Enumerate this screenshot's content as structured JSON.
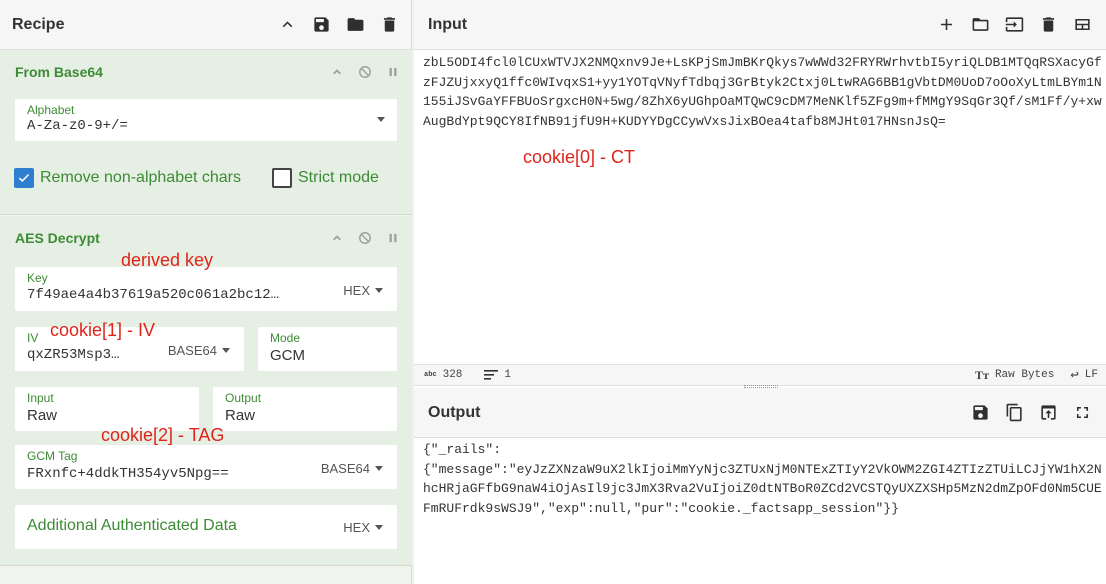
{
  "recipe": {
    "title": "Recipe"
  },
  "from_base64": {
    "name": "From Base64",
    "alphabet_label": "Alphabet",
    "alphabet_value": "A-Za-z0-9+/=",
    "remove_label": "Remove non-alphabet chars",
    "strict_label": "Strict mode"
  },
  "aes": {
    "name": "AES Decrypt",
    "key_label": "Key",
    "key_value": "7f49ae4a4b37619a520c061a2bc12…",
    "key_format": "HEX",
    "iv_label": "IV",
    "iv_value": "qxZR53Msp3…",
    "iv_format": "BASE64",
    "mode_label": "Mode",
    "mode_value": "GCM",
    "input_label": "Input",
    "input_value": "Raw",
    "output_label": "Output",
    "output_value": "Raw",
    "tag_label": "GCM Tag",
    "tag_value": "FRxnfc+4ddkTH354yv5Npg==",
    "tag_format": "BASE64",
    "aad_label": "Additional Authenticated Data",
    "aad_format": "HEX"
  },
  "annotations": {
    "derived_key": "derived key",
    "iv": "cookie[1] - IV",
    "tag": "cookie[2] - TAG",
    "ct": "cookie[0] - CT"
  },
  "input": {
    "title": "Input",
    "text": "zbL5ODI4fcl0lCUxWTVJX2NMQxnv9Je+LsKPjSmJmBKrQkys7wWWd32FRYRWrhvtbI5yriQLDB1MTQqRSXacyGfzFJZUjxxyQ1ffc0WIvqxS1+yy1YOTqVNyfTdbqj3GrBtyk2Ctxj0LtwRAG6BB1gVbtDM0UoD7oOoXyLtmLBYm1N155iJSvGaYFFBUoSrgxcH0N+5wg/8ZhX6yUGhpOaMTQwC9cDM7MeNKlf5ZFg9m+fMMgY9SqGr3Qf/sM1Ff/y+xwAugBdYpt9QCY8IfNB91jfU9H+KUDYYDgCCywVxsJixBOea4tafb8MJHt017HNsnJsQ="
  },
  "status": {
    "chars": "328",
    "lines": "1",
    "encoding": "Raw Bytes",
    "eol": "LF"
  },
  "output": {
    "title": "Output",
    "text": "{\"_rails\":\n{\"message\":\"eyJzZXNzaW9uX2lkIjoiMmYyNjc3ZTUxNjM0NTExZTIyY2VkOWM2ZGI4ZTIzZTUiLCJjYW1hX2NhcHRjaGFfbG9naW4iOjAsIl9jc3JmX3Rva2VuIjoiZ0dtNTBoR0ZCd2VCSTQyUXZXSHp5MzN2dmZpOFd0Nm5CUEFmRUFrdk9sWSJ9\",\"exp\":null,\"pur\":\"cookie._factsapp_session\"}}"
  }
}
